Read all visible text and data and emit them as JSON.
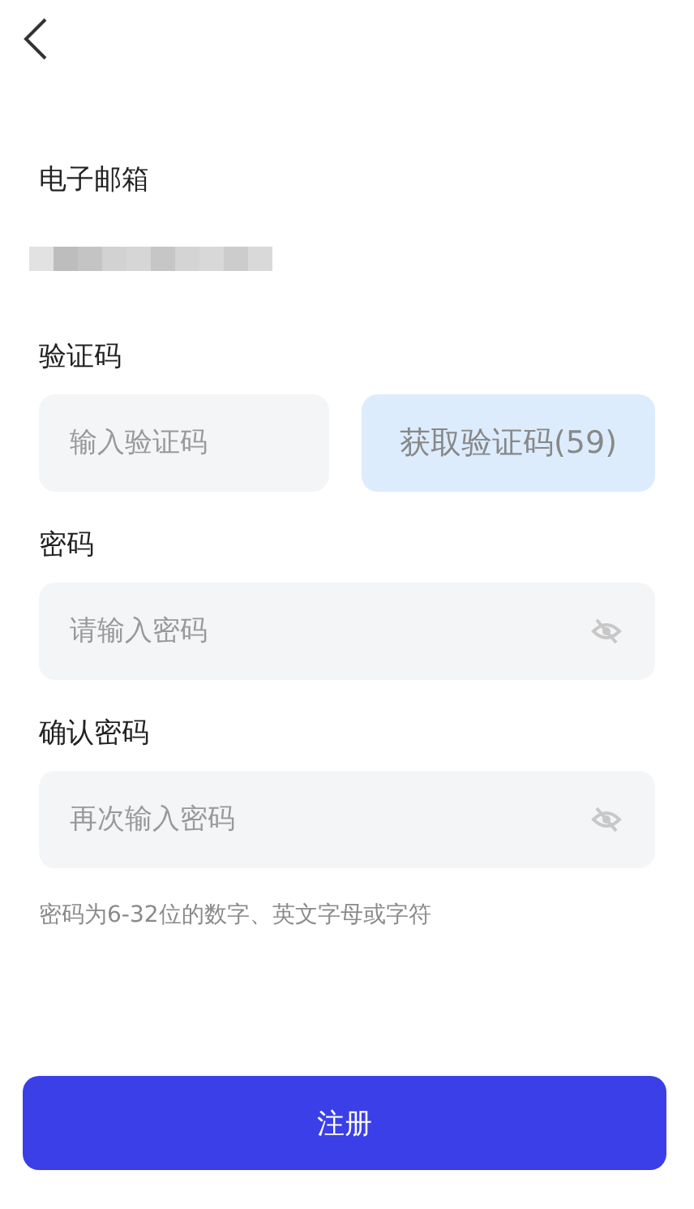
{
  "fields": [
    {
      "kind": "redacted",
      "label": "电子邮箱"
    },
    {
      "kind": "code",
      "label": "验证码",
      "placeholder": "输入验证码",
      "button": {
        "label": "获取验证码(59)",
        "disabled": true
      }
    },
    {
      "kind": "password",
      "label": "密码",
      "placeholder": "请输入密码",
      "visible": false
    },
    {
      "kind": "password",
      "label": "确认密码",
      "placeholder": "再次输入密码",
      "visible": false
    }
  ],
  "hint": "密码为6-32位的数字、英文字母或字符",
  "submit": {
    "label": "注册"
  }
}
